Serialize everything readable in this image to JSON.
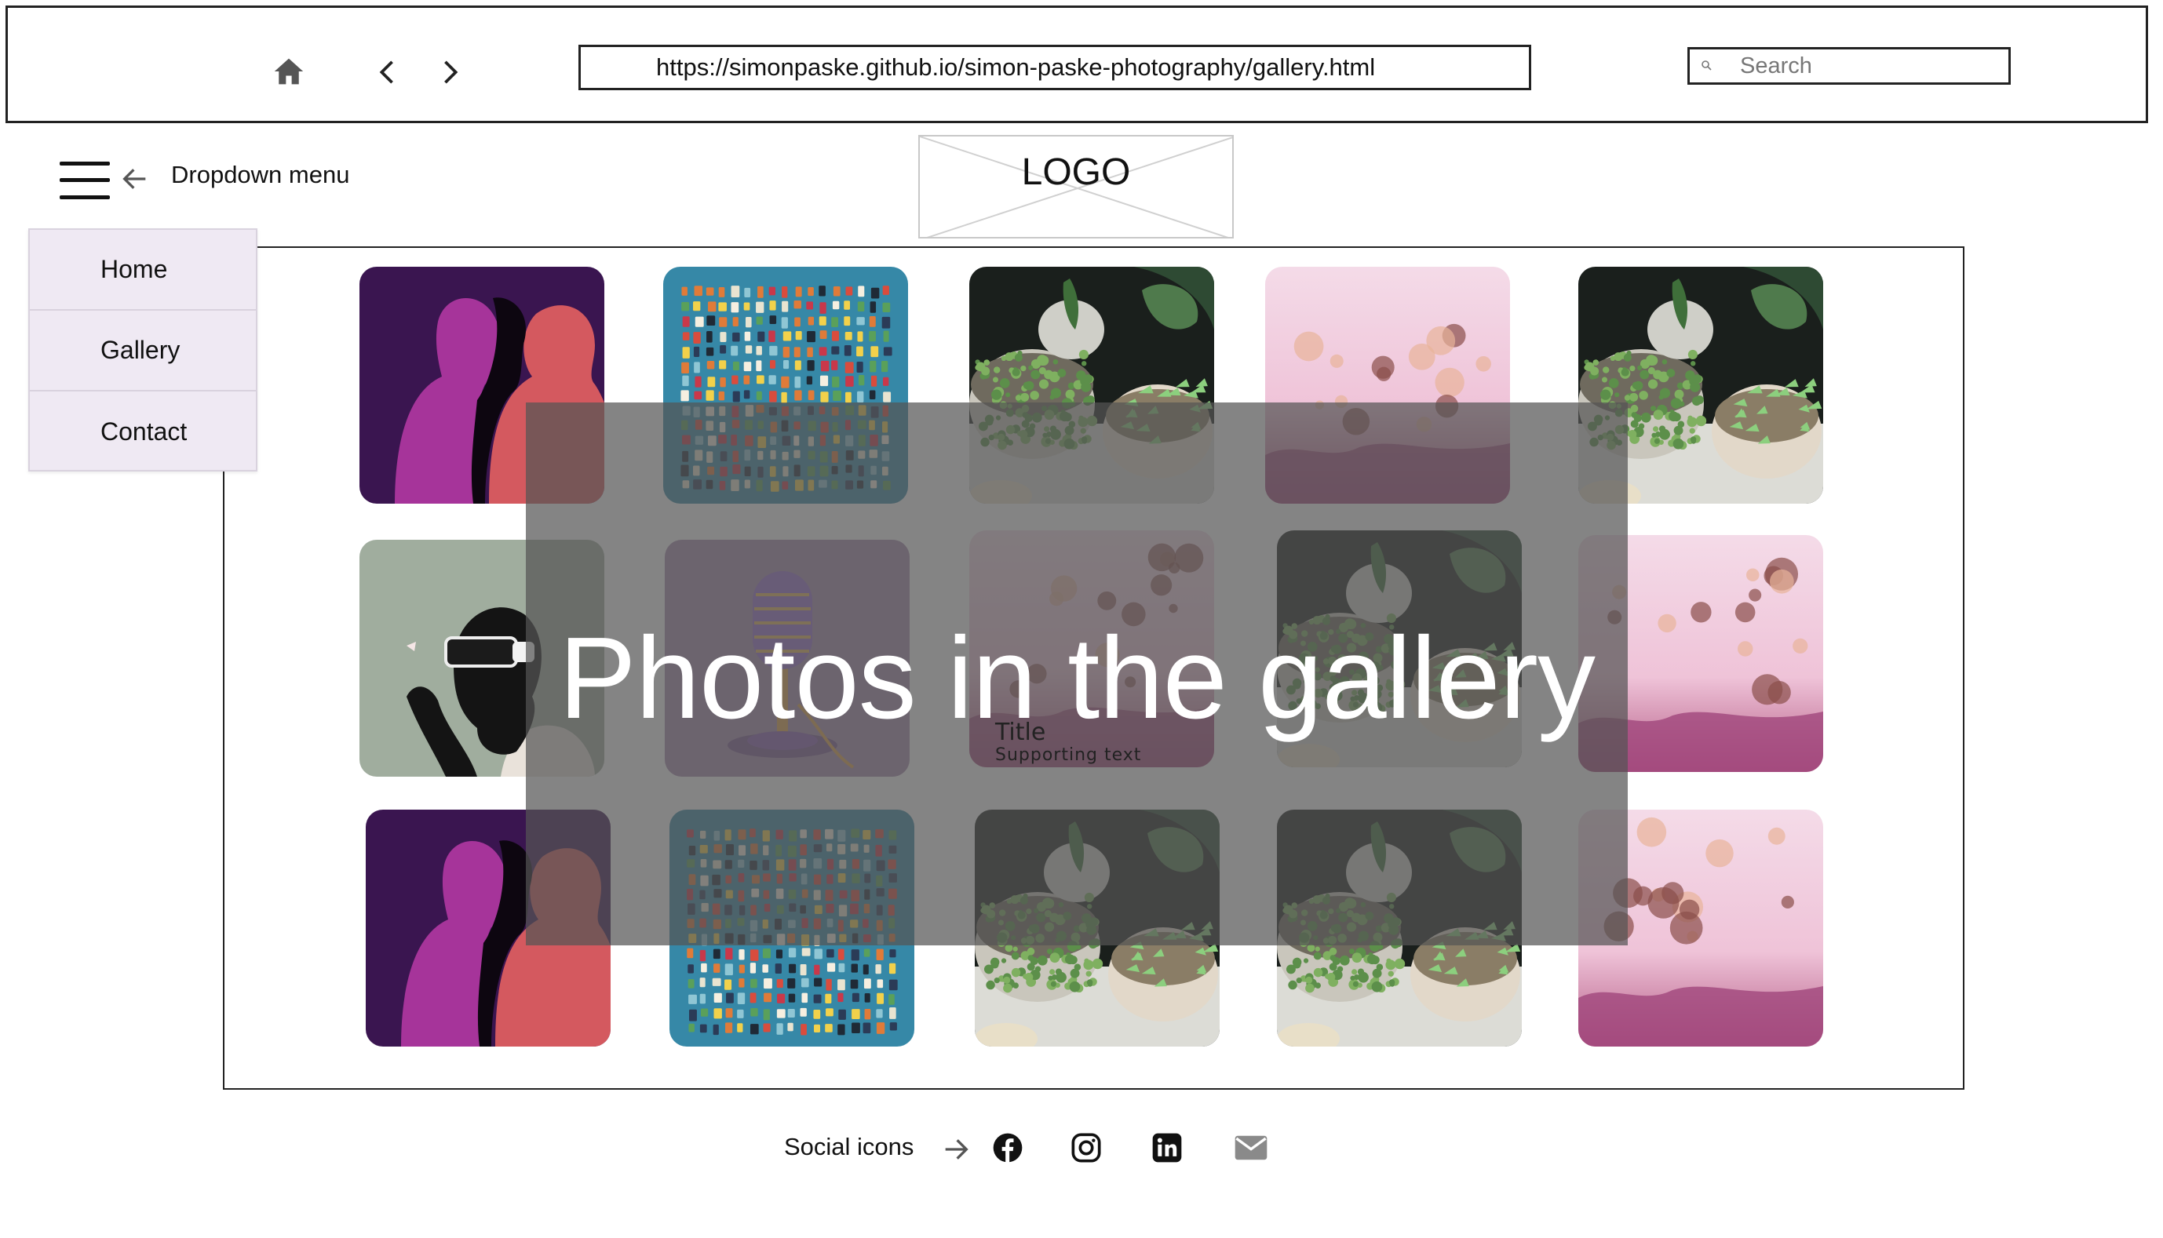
{
  "browser": {
    "url": "https://simonpaske.github.io/simon-paske-photography/gallery.html",
    "search_placeholder": "Search",
    "icons": [
      "home-icon",
      "chevron-left-icon",
      "chevron-right-icon",
      "search-icon"
    ]
  },
  "header": {
    "dropdown_label": "Dropdown menu",
    "logo_text": "LOGO",
    "icons": [
      "hamburger-icon",
      "arrow-left-icon"
    ]
  },
  "menu": {
    "items": [
      {
        "label": "Home"
      },
      {
        "label": "Gallery"
      },
      {
        "label": "Contact"
      }
    ]
  },
  "gallery": {
    "overlay_text": "Photos in the gallery",
    "tile_title": "Title",
    "tile_supporting_text": "Supporting text",
    "photos": [
      "silhouettes-art",
      "colorful-tiles-art",
      "succulent-plants",
      "pink-bokeh-flowers",
      "succulent-plants",
      "vr-headset-art",
      "microphone-art",
      "pink-bokeh-flowers",
      "succulent-plants",
      "pink-bokeh-flowers",
      "silhouettes-art",
      "colorful-tiles-art",
      "succulent-plants",
      "succulent-plants",
      "pink-bokeh-flowers"
    ]
  },
  "footer": {
    "social_label": "Social icons",
    "icons": [
      "facebook-icon",
      "instagram-icon",
      "linkedin-icon",
      "mail-icon"
    ]
  },
  "colors": {
    "menu_bg": "#efe9f3",
    "overlay": "#555555",
    "text": "#111111"
  }
}
